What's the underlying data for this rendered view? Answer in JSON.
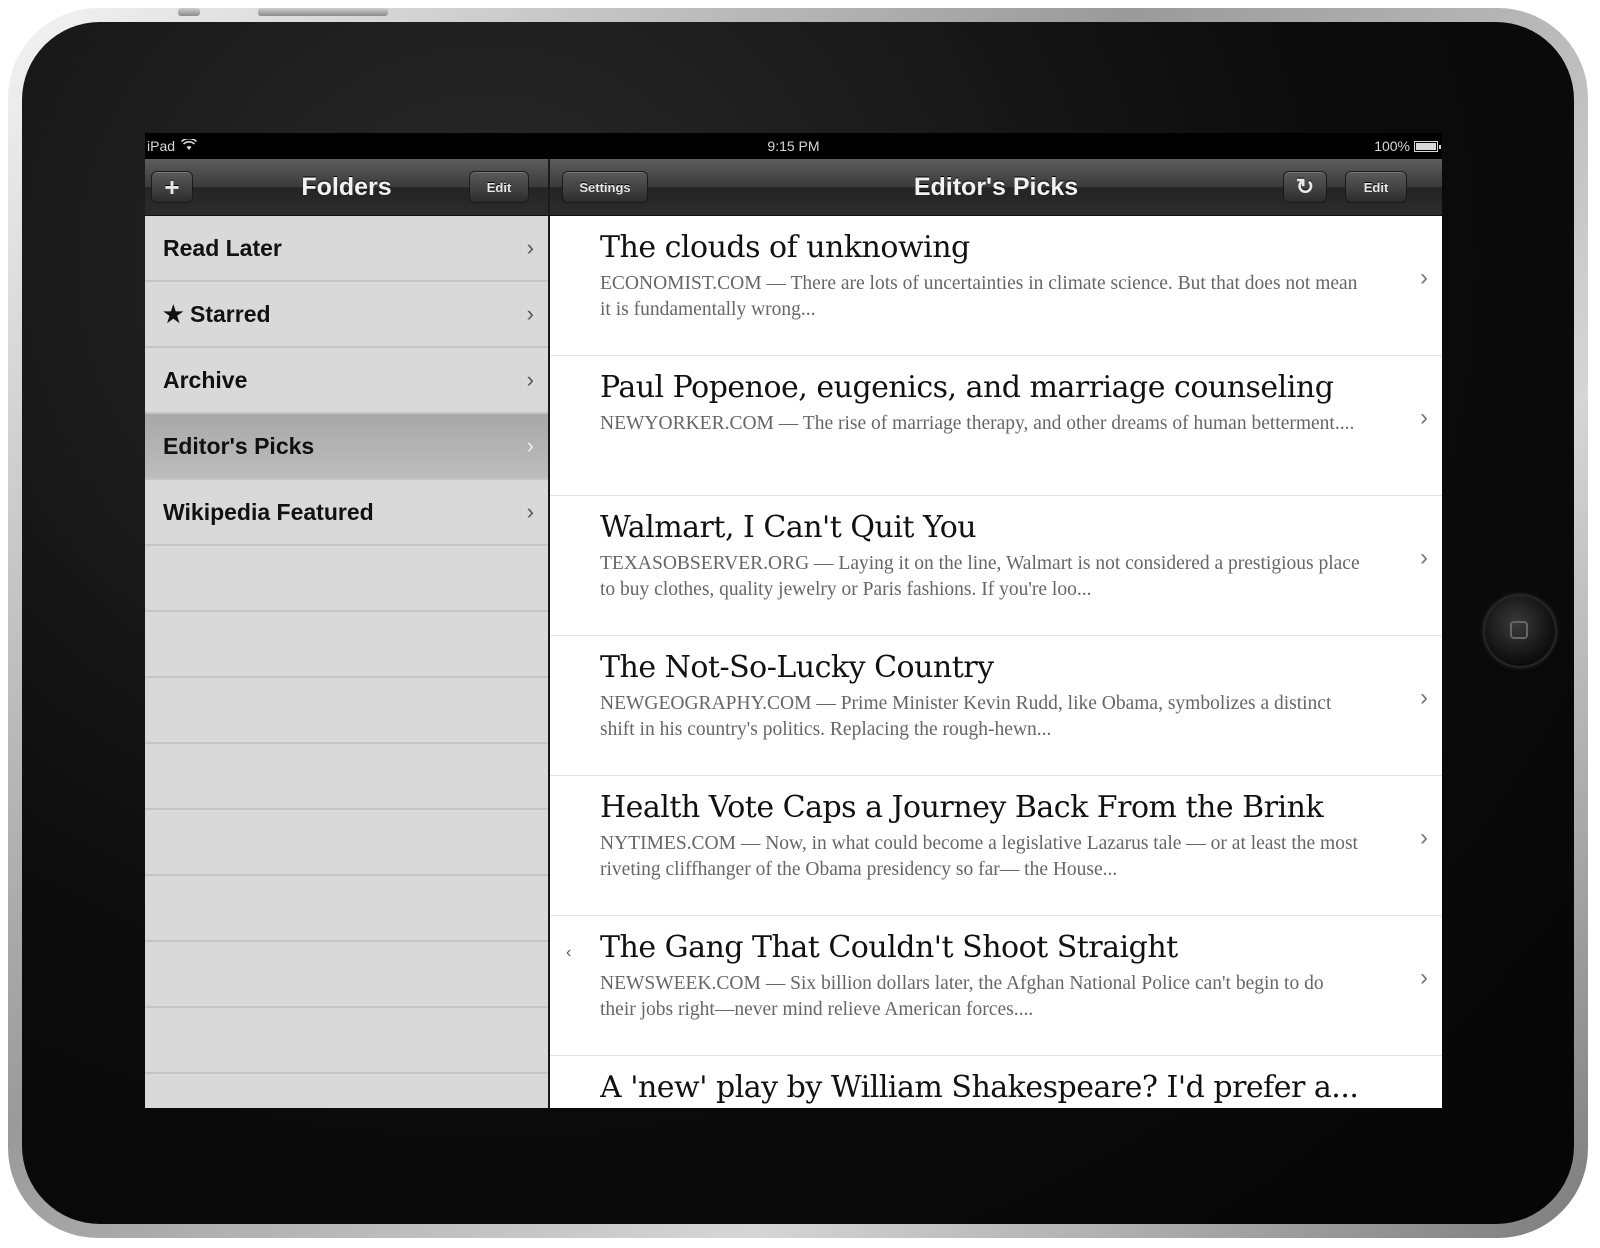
{
  "status_bar": {
    "carrier": "iPad",
    "time": "9:15 PM",
    "battery": "100%"
  },
  "folders_nav": {
    "title": "Folders",
    "add_label": "+",
    "edit_label": "Edit"
  },
  "articles_nav": {
    "title": "Editor's Picks",
    "settings_label": "Settings",
    "refresh_label": "↻",
    "edit_label": "Edit"
  },
  "folders": [
    {
      "label": "Read Later"
    },
    {
      "label": "★ Starred"
    },
    {
      "label": "Archive"
    },
    {
      "label": "Editor's Picks",
      "selected": true
    },
    {
      "label": "Wikipedia Featured"
    }
  ],
  "articles": [
    {
      "title": "The clouds of unknowing",
      "source": "ECONOMIST.COM",
      "excerpt": "There are lots of uncertainties in climate science. But that does not mean it is fundamentally wrong..."
    },
    {
      "title": "Paul Popenoe, eugenics, and marriage counseling",
      "source": "NEWYORKER.COM",
      "excerpt": "The rise of marriage therapy, and other dreams of human betterment...."
    },
    {
      "title": "Walmart, I Can't Quit You",
      "source": "TEXASOBSERVER.ORG",
      "excerpt": "Laying it on the line, Walmart is not considered a prestigious place to buy clothes, quality jewelry or Paris fashions. If you're loo..."
    },
    {
      "title": "The Not-So-Lucky Country",
      "source": "NEWGEOGRAPHY.COM",
      "excerpt": "Prime Minister Kevin Rudd, like Obama, symbolizes a distinct shift in his country's politics. Replacing the rough-hewn..."
    },
    {
      "title": "Health Vote Caps a Journey Back From the Brink",
      "source": "NYTIMES.COM",
      "excerpt": "Now, in what could become a legislative Lazarus tale — or at least the most riveting cliffhanger of the Obama presidency so far— the House..."
    },
    {
      "title": "The Gang That Couldn't Shoot Straight",
      "source": "NEWSWEEK.COM",
      "excerpt": "Six billion dollars later, the Afghan National Police can't begin to do their jobs right—never mind relieve American forces....",
      "marker": "‹"
    },
    {
      "title": "A 'new' play by William Shakespeare? I'd prefer a...",
      "source": "",
      "excerpt": ""
    }
  ],
  "icons": {
    "chevron": "›",
    "wifi": "wifi-icon"
  }
}
